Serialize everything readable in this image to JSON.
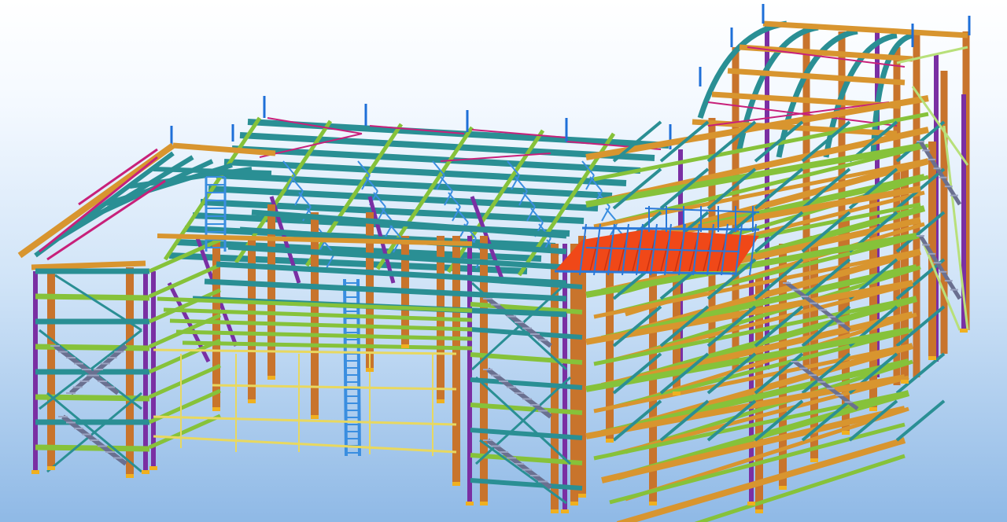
{
  "viewport": {
    "background_top": "#ffffff",
    "background_bottom": "#8fb9e6"
  },
  "palette": {
    "column": "#c8742c",
    "column_purple": "#7a2fa3",
    "beam_teal": "#2a8f94",
    "beam_orange": "#d8952f",
    "beam_green": "#86c23a",
    "beam_lightgreen": "#b8e07a",
    "brace_blue": "#3a8ee0",
    "brace_magenta": "#c8207a",
    "post_blue": "#1e6fd8",
    "deck_red": "#f04818",
    "handrail_blue": "#2a78d8",
    "baseplate": "#f0b020",
    "stair": "#6a7090",
    "wall_yellow": "#e8d860"
  }
}
